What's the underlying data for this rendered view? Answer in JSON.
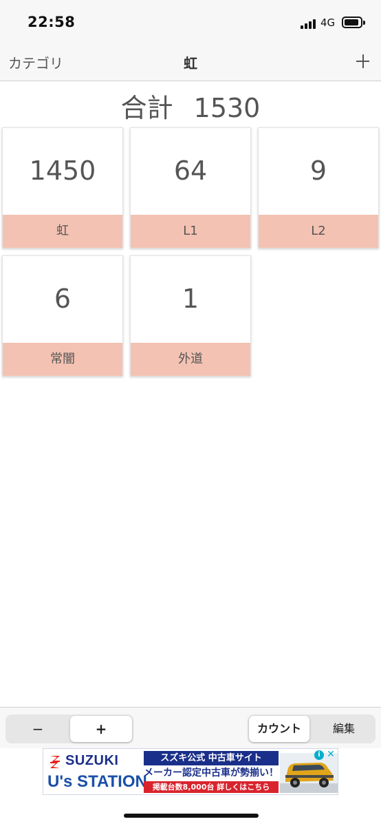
{
  "status_bar": {
    "time": "22:58",
    "network": "4G"
  },
  "nav": {
    "back_label": "カテゴリ",
    "title": "虹",
    "add_icon": "plus-icon"
  },
  "total": {
    "label": "合計",
    "value": "1530"
  },
  "cards": [
    {
      "count": "1450",
      "label": "虹"
    },
    {
      "count": "64",
      "label": "L1"
    },
    {
      "count": "9",
      "label": "L2"
    },
    {
      "count": "6",
      "label": "常闇"
    },
    {
      "count": "1",
      "label": "外道"
    }
  ],
  "toolbar": {
    "minus_label": "−",
    "plus_label": "+",
    "selected_step": "+",
    "count_mode_label": "カウント",
    "edit_mode_label": "編集",
    "selected_mode": "カウント"
  },
  "ad": {
    "brand": "SUZUKI",
    "sub_brand": "U's STATION",
    "line1": "スズキ公式 中古車サイト",
    "line2": "メーカー認定中古車が勢揃い！",
    "line3": "掲載台数8,000台 詳しくはこちら",
    "info_icon": "info-icon",
    "close_icon": "close-icon"
  },
  "colors": {
    "card_label_bg": "#f3c2b2",
    "brand_blue": "#1a2f8a",
    "ad_red": "#d9232d"
  }
}
